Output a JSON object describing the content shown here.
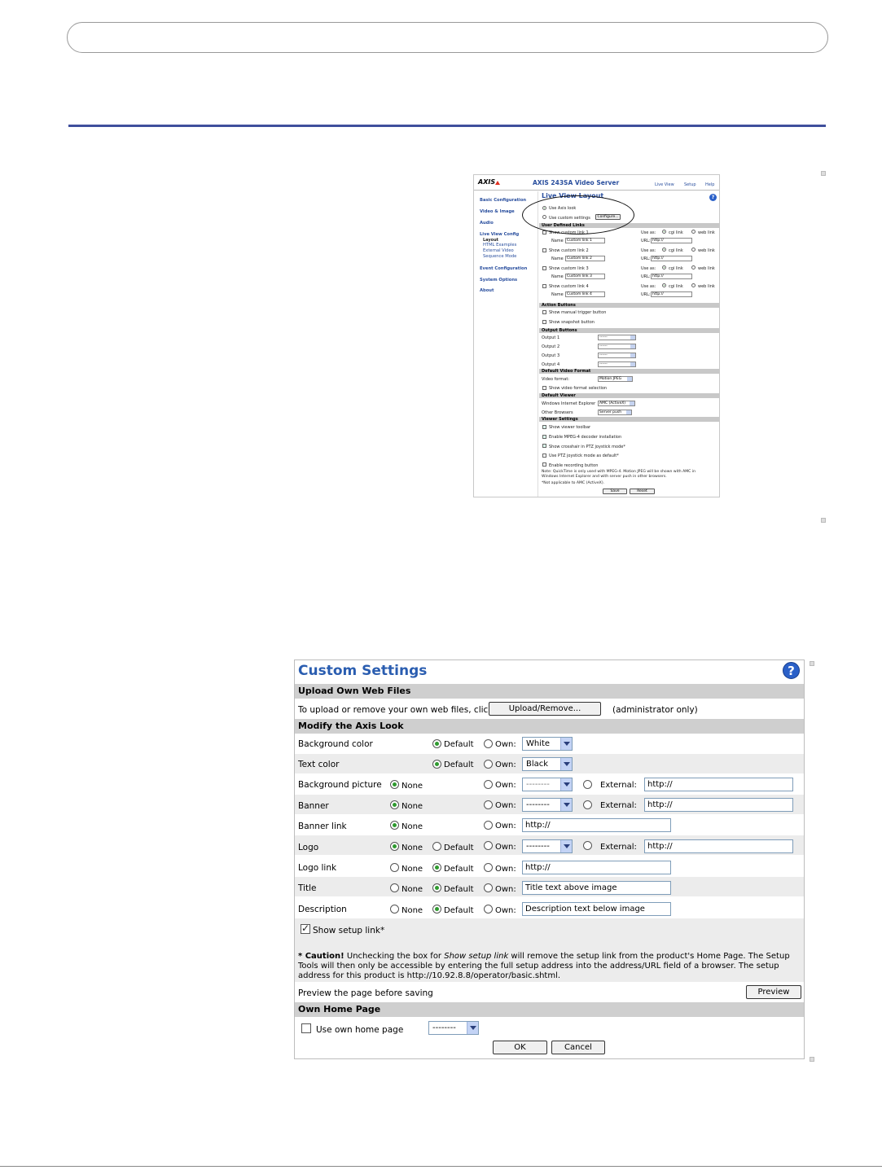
{
  "thumbnail": {
    "brand": "AXIS",
    "app_title": "AXIS 243SA Video Server",
    "top_links": [
      "Live View",
      "Setup",
      "Help"
    ],
    "page_title": "Live View Layout",
    "nav": [
      {
        "label": "Basic Configuration",
        "level": 1
      },
      {
        "label": "Video & Image",
        "level": 1
      },
      {
        "label": "Audio",
        "level": 1
      },
      {
        "label": "Live View Config",
        "level": 1
      },
      {
        "label": "Layout",
        "level": 2
      },
      {
        "label": "HTML Examples",
        "level": 2
      },
      {
        "label": "External Video",
        "level": 2
      },
      {
        "label": "Sequence Mode",
        "level": 2
      },
      {
        "label": "Event Configuration",
        "level": 1
      },
      {
        "label": "System Options",
        "level": 1
      },
      {
        "label": "About",
        "level": 1
      }
    ],
    "use_axis_look": "Use Axis look",
    "use_custom_settings": "Use custom settings",
    "configure_button": "Configure...",
    "sections": {
      "user_links": "User Defined Links",
      "action_buttons": "Action Buttons",
      "output_buttons": "Output Buttons",
      "video_format": "Default Video Format",
      "viewer": "Default Viewer",
      "viewer_settings": "Viewer Settings"
    },
    "links": [
      {
        "show": "Show custom link 1",
        "name_label": "Name",
        "name": "Custom link 1",
        "use_as": "Use as:",
        "cgi": "cgi link",
        "web": "web link",
        "url_label": "URL:",
        "url": "http://"
      },
      {
        "show": "Show custom link 2",
        "name_label": "Name",
        "name": "Custom link 2",
        "use_as": "Use as:",
        "cgi": "cgi link",
        "web": "web link",
        "url_label": "URL:",
        "url": "http://"
      },
      {
        "show": "Show custom link 3",
        "name_label": "Name",
        "name": "Custom link 3",
        "use_as": "Use as:",
        "cgi": "cgi link",
        "web": "web link",
        "url_label": "URL:",
        "url": "http://"
      },
      {
        "show": "Show custom link 4",
        "name_label": "Name",
        "name": "Custom link 4",
        "use_as": "Use as:",
        "cgi": "cgi link",
        "web": "web link",
        "url_label": "URL:",
        "url": "http://"
      }
    ],
    "action_items": [
      "Show manual trigger button",
      "Show snapshot button"
    ],
    "outputs": [
      {
        "label": "Output 1",
        "value": "------"
      },
      {
        "label": "Output 2",
        "value": "------"
      },
      {
        "label": "Output 3",
        "value": "------"
      },
      {
        "label": "Output 4",
        "value": "------"
      }
    ],
    "video_format_label": "Video format:",
    "video_format_value": "Motion JPEG",
    "show_video_format": "Show video format selection",
    "viewer_ie_label": "Windows Internet Explorer",
    "viewer_ie_value": "AMC (ActiveX)",
    "viewer_other_label": "Other Browsers",
    "viewer_other_value": "Server push",
    "viewer_settings": [
      "Show viewer toolbar",
      "Enable MPEG-4 decoder installation",
      "Show crosshair in PTZ joystick mode*",
      "Use PTZ joystick mode as default*",
      "Enable recording button"
    ],
    "note1": "Note: QuickTime is only used with MPEG-4. Motion JPEG will be shown with AMC in",
    "note2": "Windows Internet Explorer and with server push in other browsers.",
    "note3": "*Not applicable to AMC (ActiveX).",
    "save": "Save",
    "reset": "Reset"
  },
  "panel": {
    "title": "Custom Settings",
    "help_glyph": "?",
    "upload_header": "Upload Own Web Files",
    "upload_text": "To upload or remove your own web files, click",
    "upload_button": "Upload/Remove...",
    "upload_admin": "(administrator only)",
    "modify_header": "Modify the Axis Look",
    "opt_none": "None",
    "opt_default": "Default",
    "opt_own": "Own:",
    "opt_external": "External:",
    "rows": [
      {
        "label": "Background color",
        "value": "White"
      },
      {
        "label": "Text color",
        "value": "Black"
      },
      {
        "label": "Background picture",
        "own": "--------",
        "external": "http://"
      },
      {
        "label": "Banner",
        "own": "--------",
        "external": "http://"
      },
      {
        "label": "Banner link",
        "own": "http://"
      },
      {
        "label": "Logo",
        "own": "--------",
        "external": "http://"
      },
      {
        "label": "Logo link",
        "own": "http://"
      },
      {
        "label": "Title",
        "own": "Title text above image"
      },
      {
        "label": "Description",
        "own": "Description text below image"
      }
    ],
    "show_setup_link": "Show setup link*",
    "caution_bold": "* Caution!",
    "caution_1": "Unchecking the box for",
    "caution_italic": "Show setup link",
    "caution_2": "will remove the setup link from the product's Home Page. The Setup Tools will then only be accessible by entering the full setup address into the address/URL field of a browser. The setup address for this product is http://10.92.8.8/operator/basic.shtml.",
    "preview_text": "Preview the page before saving",
    "preview_button": "Preview",
    "home_header": "Own Home Page",
    "use_home": "Use own home page",
    "home_select": "--------",
    "ok": "OK",
    "cancel": "Cancel"
  }
}
